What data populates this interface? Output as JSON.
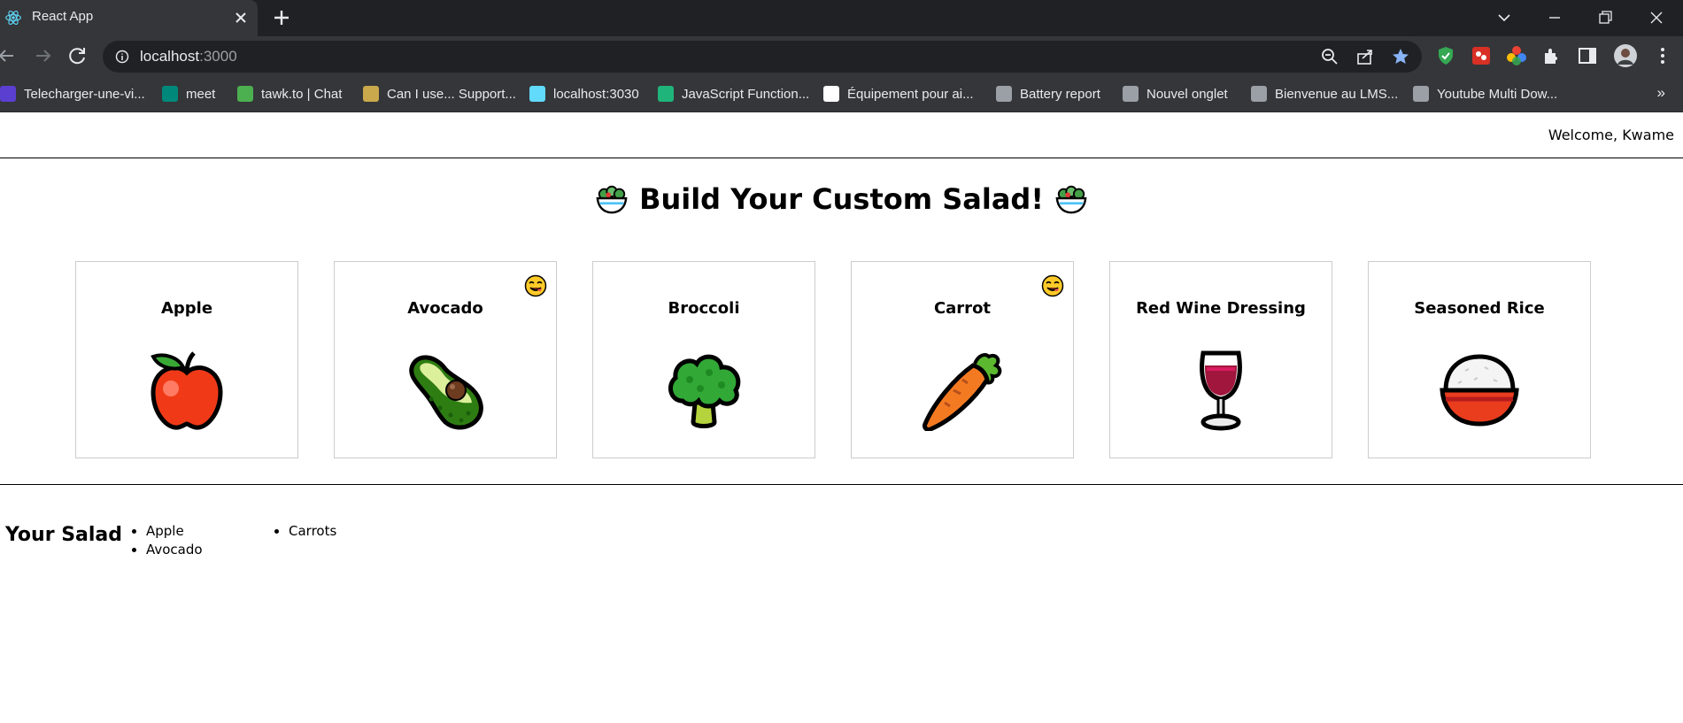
{
  "browser": {
    "tab_title": "React App",
    "url_host": "localhost",
    "url_port": ":3000",
    "bookmarks": [
      {
        "label": "Telecharger-une-vi...",
        "color": "#5b3fd1"
      },
      {
        "label": "meet",
        "color": "#00897b"
      },
      {
        "label": "tawk.to | Chat",
        "color": "#4caf50"
      },
      {
        "label": "Can I use... Support...",
        "color": "#c9a94b"
      },
      {
        "label": "localhost:3030",
        "color": "#61dafb"
      },
      {
        "label": "JavaScript Function...",
        "color": "#1fb57a"
      },
      {
        "label": "Équipement pour ai...",
        "color": "#ffffff"
      },
      {
        "label": "Battery report",
        "color": "#9aa0a6"
      },
      {
        "label": "Nouvel onglet",
        "color": "#9aa0a6"
      },
      {
        "label": "Bienvenue au LMS...",
        "color": "#9aa0a6"
      },
      {
        "label": "Youtube Multi Dow...",
        "color": "#9aa0a6"
      }
    ],
    "more_bookmarks": "»"
  },
  "app": {
    "welcome": "Welcome, Kwame",
    "heading": "Build Your Custom Salad!",
    "ingredients": [
      {
        "name": "Apple",
        "icon": "apple-icon",
        "favorite": false
      },
      {
        "name": "Avocado",
        "icon": "avocado-icon",
        "favorite": true
      },
      {
        "name": "Broccoli",
        "icon": "broccoli-icon",
        "favorite": false
      },
      {
        "name": "Carrot",
        "icon": "carrot-icon",
        "favorite": true
      },
      {
        "name": "Red Wine Dressing",
        "icon": "wine-glass-icon",
        "favorite": false
      },
      {
        "name": "Seasoned Rice",
        "icon": "rice-bowl-icon",
        "favorite": false
      }
    ],
    "salad": {
      "title": "Your Salad",
      "items": [
        "Apple",
        "Avocado",
        "Carrots"
      ]
    }
  },
  "colors": {
    "chrome_dark": "#202124",
    "chrome_mid": "#35363a",
    "card_border": "#cccccc",
    "star_blue": "#8ab4f8"
  }
}
